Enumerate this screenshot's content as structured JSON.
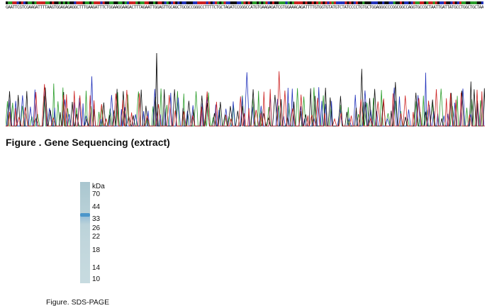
{
  "sequence_strip": {
    "text": "GAATTCGTCGAAGATTTTAAGTGGAGAGAGGCTTTGAAGATTTCTGGAAGGAAGACTTTAGAATTGGAGTTGCAGCTGCGCCGGGCCTTTTCTGCTAGATCCGGGCCATGTGAAGAGATCGTGGAAACAGATTTTGTGGTGTATGTCTATCCCCTGTGCTGGAGGGCCCGGCGGCCAGGTGCCGCTAATTGATTATGCCTGGCTGCTAAGGAAAGGC"
  },
  "figures": {
    "sequencing_caption": "Figure . Gene Sequencing (extract)",
    "sds_caption": "Figure. SDS-PAGE"
  },
  "sds_page": {
    "unit_label": "kDa",
    "markers": [
      "70",
      "44",
      "33",
      "26",
      "22",
      "18",
      "14",
      "10"
    ]
  },
  "colors": {
    "trace_A": "#2a9d2a",
    "trace_C": "#2233bb",
    "trace_G": "#111111",
    "trace_T": "#cc2222",
    "band": "#3f8fc9"
  }
}
